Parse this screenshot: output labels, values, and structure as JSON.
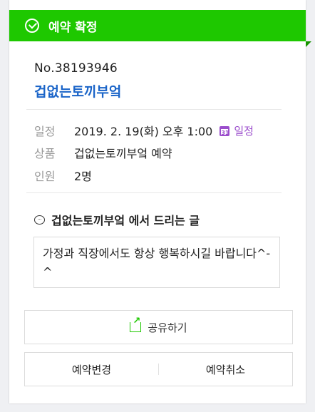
{
  "status": {
    "label": "예약 확정",
    "icon": "check-circle-icon",
    "color": "#1ec800"
  },
  "booking": {
    "number": "No.38193946",
    "business_name": "겁없는토끼부엌"
  },
  "details": {
    "date": {
      "label": "일정",
      "value": "2019. 2. 19(화) 오후 1:00",
      "calendar_day": "31",
      "calendar_link": "일정"
    },
    "product": {
      "label": "상품",
      "value": "겁없는토끼부엌 예약"
    },
    "people": {
      "label": "인원",
      "value": "2명"
    }
  },
  "message": {
    "title": "겁없는토끼부엌 에서 드리는 글",
    "body": "가정과 직장에서도 항상 행복하시길 바랍니다^-^"
  },
  "actions": {
    "share": "공유하기",
    "change": "예약변경",
    "cancel": "예약취소"
  },
  "colors": {
    "accent": "#1ec800",
    "link": "#1a64c8",
    "calendar": "#9b4dcc"
  }
}
